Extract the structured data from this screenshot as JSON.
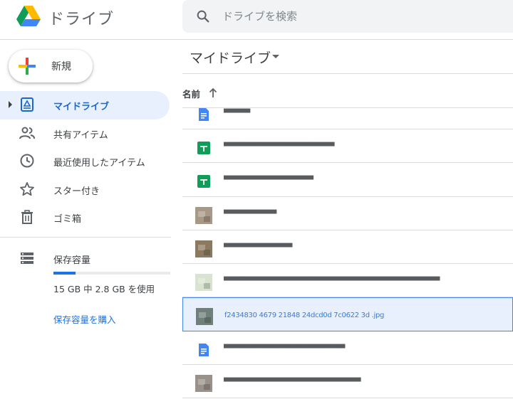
{
  "app": {
    "title": "ドライブ"
  },
  "search": {
    "placeholder": "ドライブを検索",
    "value": ""
  },
  "new_button": {
    "label": "新規"
  },
  "sidebar": {
    "items": [
      {
        "label": "マイドライブ",
        "icon": "my-drive-icon",
        "active": true
      },
      {
        "label": "共有アイテム",
        "icon": "shared-people-icon",
        "active": false
      },
      {
        "label": "最近使用したアイテム",
        "icon": "clock-icon",
        "active": false
      },
      {
        "label": "スター付き",
        "icon": "star-icon",
        "active": false
      },
      {
        "label": "ゴミ箱",
        "icon": "trash-icon",
        "active": false
      }
    ],
    "storage": {
      "label": "保存容量",
      "usage": "15 GB 中 2.8 GB を使用",
      "used_fraction": 0.187,
      "buy_label": "保存容量を購入"
    }
  },
  "main": {
    "title": "マイドライブ",
    "column_name": "名前",
    "files": [
      {
        "name": "▀▀▀▀▀",
        "type": "doc",
        "icon": "google-docs-icon"
      },
      {
        "name": "▀▀▀▀▀▀▀▀▀▀▀▀▀▀▀▀▀▀▀▀▀",
        "type": "sheet",
        "icon": "google-sheets-icon"
      },
      {
        "name": "▀▀▀▀▀▀▀▀▀▀▀▀▀▀▀▀▀",
        "type": "sheet",
        "icon": "google-sheets-icon"
      },
      {
        "name": "▀▀▀▀▀▀▀▀▀▀",
        "type": "image",
        "icon": "image-thumbnail-icon",
        "thumb": "#a89886"
      },
      {
        "name": "▀▀▀▀▀▀▀▀▀▀▀▀▀",
        "type": "image",
        "icon": "image-thumbnail-icon",
        "thumb": "#8c7a60"
      },
      {
        "name": "▀▀▀▀▀▀▀▀▀▀▀▀▀▀▀▀▀▀▀▀▀▀▀▀▀▀▀▀▀▀▀▀▀▀▀▀▀▀▀▀▀",
        "type": "image",
        "icon": "image-thumbnail-icon",
        "thumb": "#d8e4d0"
      },
      {
        "name": "f2434830 4679 21848 24dcd0d 7c0622 3d .jpg",
        "type": "image",
        "icon": "image-thumbnail-icon",
        "thumb": "#6f7f7a",
        "selected": true
      },
      {
        "name": "▀▀▀▀▀▀▀▀▀▀▀▀▀▀▀▀▀▀▀▀▀▀▀",
        "type": "doc",
        "icon": "google-docs-icon"
      },
      {
        "name": "▀▀▀▀▀▀▀▀▀▀▀▀▀▀▀▀▀▀▀▀▀▀▀▀▀▀",
        "type": "image",
        "icon": "image-thumbnail-icon",
        "thumb": "#9a928a"
      }
    ]
  },
  "colors": {
    "accent": "#1a73e8",
    "active_bg": "#e8f0fe",
    "active_text": "#1967d2",
    "sheets_green": "#0f9d58",
    "docs_blue": "#4285f4"
  }
}
